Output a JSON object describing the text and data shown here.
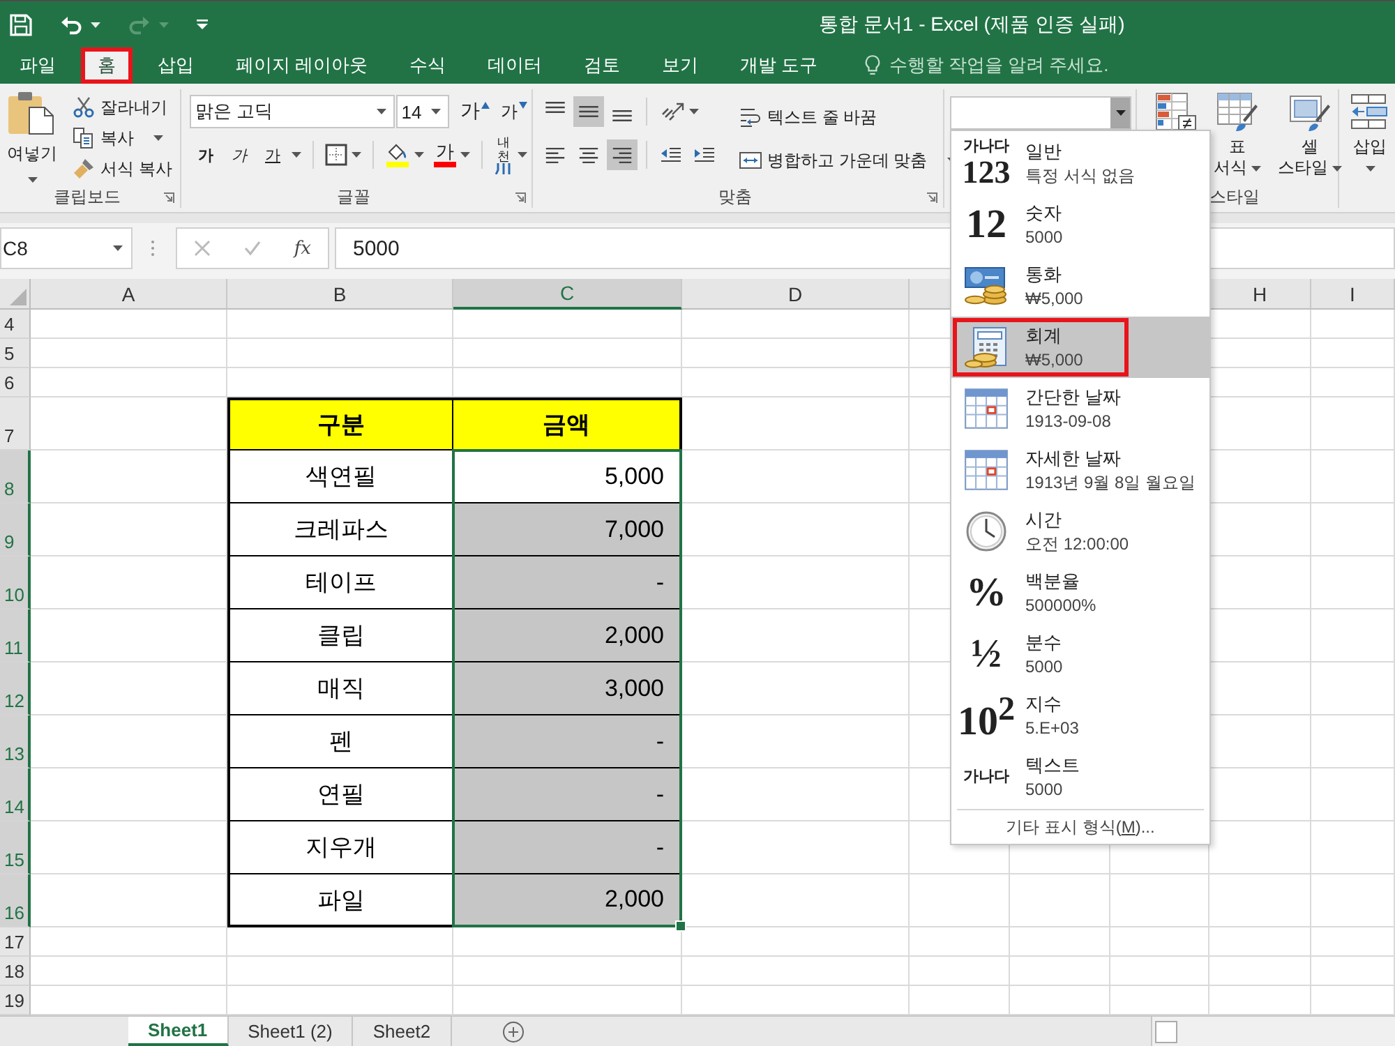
{
  "title_bar": {
    "title": "통합 문서1 - Excel (제품 인증 실패)",
    "quick_access": [
      {
        "kind": "save",
        "disabled": false
      },
      {
        "kind": "undo",
        "disabled": false
      },
      {
        "kind": "redo",
        "disabled": true
      },
      {
        "kind": "customize",
        "disabled": false
      }
    ]
  },
  "ribbon_tabs": [
    {
      "label": "파일",
      "selected": false,
      "marked": false
    },
    {
      "label": "홈",
      "selected": true,
      "marked": true
    },
    {
      "label": "삽입",
      "selected": false,
      "marked": false
    },
    {
      "label": "페이지 레이아웃",
      "selected": false,
      "marked": false
    },
    {
      "label": "수식",
      "selected": false,
      "marked": false
    },
    {
      "label": "데이터",
      "selected": false,
      "marked": false
    },
    {
      "label": "검토",
      "selected": false,
      "marked": false
    },
    {
      "label": "보기",
      "selected": false,
      "marked": false
    },
    {
      "label": "개발 도구",
      "selected": false,
      "marked": false
    }
  ],
  "tell_me": {
    "placeholder": "수행할 작업을 알려 주세요."
  },
  "clipboard": {
    "paste": "여넣기",
    "cut": "잘라내기",
    "copy": "복사",
    "format_painter": "서식 복사",
    "label": "클립보드"
  },
  "font": {
    "name": "맑은 고딕",
    "size": "14",
    "grow": "가",
    "shrink": "가",
    "bold": "가",
    "italic": "가",
    "underline": "가",
    "font_color": "가",
    "phonetic": "내천",
    "label": "글꼴"
  },
  "alignment": {
    "vertical": [
      {
        "kind": "top",
        "selected": false
      },
      {
        "kind": "middle",
        "selected": true
      },
      {
        "kind": "bottom",
        "selected": false
      }
    ],
    "horizontal": [
      {
        "kind": "left",
        "selected": false
      },
      {
        "kind": "center",
        "selected": false
      },
      {
        "kind": "right",
        "selected": true
      }
    ],
    "wrap_text": "텍스트 줄 바꿈",
    "merge_center": "병합하고 가운데 맞춤",
    "label": "맞춤"
  },
  "number_format": {
    "expanded": true,
    "options": [
      {
        "kind": "general",
        "glyph_lines": [
          "가나다",
          "123"
        ],
        "name": "일반",
        "example": "특정 서식 없음",
        "selected": false,
        "marked": false
      },
      {
        "kind": "big-glyph",
        "glyph_lines": [
          "12"
        ],
        "name": "숫자",
        "example": "5000",
        "selected": false,
        "marked": false
      },
      {
        "kind": "banknote",
        "name": "통화",
        "example": "₩5,000",
        "selected": false,
        "marked": false
      },
      {
        "kind": "calculator",
        "name": "회계",
        "example": "₩5,000",
        "selected": true,
        "marked": true
      },
      {
        "kind": "calendar",
        "name": "간단한 날짜",
        "example": "1913-09-08",
        "selected": false,
        "marked": false
      },
      {
        "kind": "calendar",
        "name": "자세한 날짜",
        "example": "1913년 9월 8일 월요일",
        "selected": false,
        "marked": false
      },
      {
        "kind": "clock",
        "name": "시간",
        "example": "오전 12:00:00",
        "selected": false,
        "marked": false
      },
      {
        "kind": "big-glyph",
        "glyph_lines": [
          "%"
        ],
        "name": "백분율",
        "example": "500000%",
        "selected": false,
        "marked": false
      },
      {
        "kind": "big-glyph",
        "glyph_lines": [
          "½"
        ],
        "name": "분수",
        "example": "5000",
        "selected": false,
        "marked": false
      },
      {
        "kind": "big-glyph",
        "glyph_lines": [
          "10$^{2}$"
        ],
        "name": "지수",
        "example": "5.E+03",
        "selected": false,
        "marked": false
      },
      {
        "kind": "small-glyph",
        "glyph_lines": [
          "가나다"
        ],
        "name": "텍스트",
        "example": "5000",
        "selected": false,
        "marked": false
      }
    ],
    "more": {
      "before": "기타 표시 형식(",
      "key": "M",
      "after": ")..."
    }
  },
  "styles": {
    "format_as_table": [
      "표",
      "서식"
    ],
    "cell_styles": [
      "셀",
      "스타일"
    ],
    "label": "스타일"
  },
  "cells": {
    "insert": "삽입"
  },
  "formula_bar": {
    "name_box": "C8",
    "function": "fx",
    "formula": "5000"
  },
  "sheet": {
    "columns": [
      {
        "kind": "letter",
        "label": "A",
        "selected": false
      },
      {
        "kind": "letter",
        "label": "B",
        "selected": false
      },
      {
        "kind": "letter",
        "label": "C",
        "selected": true
      },
      {
        "kind": "letter",
        "label": "D",
        "selected": false
      },
      {
        "kind": "covered"
      },
      {
        "kind": "covered"
      },
      {
        "kind": "covered"
      },
      {
        "kind": "letter",
        "label": "H",
        "selected": false
      },
      {
        "kind": "letter",
        "label": "I",
        "selected": false
      }
    ],
    "rows": [
      {
        "number": "4",
        "selected": false,
        "kind": "empty"
      },
      {
        "number": "5",
        "selected": false,
        "kind": "empty"
      },
      {
        "number": "6",
        "selected": false,
        "kind": "empty"
      },
      {
        "number": "7",
        "selected": false,
        "kind": "header",
        "cells": [
          "구분",
          "금액"
        ]
      },
      {
        "number": "8",
        "selected": true,
        "kind": "data",
        "item": "색연필",
        "amount": "5,000",
        "amount_selected": true,
        "active": true
      },
      {
        "number": "9",
        "selected": true,
        "kind": "data",
        "item": "크레파스",
        "amount": "7,000",
        "amount_selected": true,
        "active": false
      },
      {
        "number": "10",
        "selected": true,
        "kind": "data",
        "item": "테이프",
        "amount": "-",
        "amount_selected": true,
        "active": false
      },
      {
        "number": "11",
        "selected": true,
        "kind": "data",
        "item": "클립",
        "amount": "2,000",
        "amount_selected": true,
        "active": false
      },
      {
        "number": "12",
        "selected": true,
        "kind": "data",
        "item": "매직",
        "amount": "3,000",
        "amount_selected": true,
        "active": false
      },
      {
        "number": "13",
        "selected": true,
        "kind": "data",
        "item": "펜",
        "amount": "-",
        "amount_selected": true,
        "active": false
      },
      {
        "number": "14",
        "selected": true,
        "kind": "data",
        "item": "연필",
        "amount": "-",
        "amount_selected": true,
        "active": false
      },
      {
        "number": "15",
        "selected": true,
        "kind": "data",
        "item": "지우개",
        "amount": "-",
        "amount_selected": true,
        "active": false
      },
      {
        "number": "16",
        "selected": true,
        "kind": "data",
        "item": "파일",
        "amount": "2,000",
        "amount_selected": true,
        "active": false
      },
      {
        "number": "17",
        "selected": false,
        "kind": "empty"
      },
      {
        "number": "18",
        "selected": false,
        "kind": "empty"
      },
      {
        "number": "19",
        "selected": false,
        "kind": "empty"
      }
    ]
  },
  "sheet_tabs": [
    {
      "label": "Sheet1",
      "selected": true
    },
    {
      "label": "Sheet1 (2)",
      "selected": false
    },
    {
      "label": "Sheet2",
      "selected": false
    }
  ]
}
